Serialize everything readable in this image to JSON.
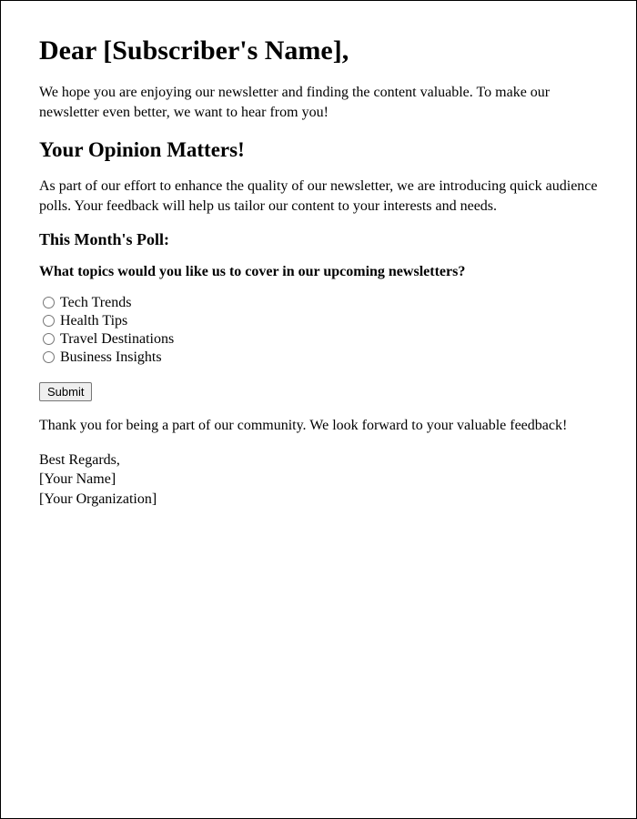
{
  "greeting": "Dear [Subscriber's Name],",
  "intro": "We hope you are enjoying our newsletter and finding the content valuable. To make our newsletter even better, we want to hear from you!",
  "section_heading": "Your Opinion Matters!",
  "section_body": "As part of our effort to enhance the quality of our newsletter, we are introducing quick audience polls. Your feedback will help us tailor our content to your interests and needs.",
  "poll_heading": "This Month's Poll:",
  "poll_question": "What topics would you like us to cover in our upcoming newsletters?",
  "options": {
    "0": "Tech Trends",
    "1": "Health Tips",
    "2": "Travel Destinations",
    "3": "Business Insights"
  },
  "submit_label": "Submit",
  "thanks": "Thank you for being a part of our community. We look forward to your valuable feedback!",
  "signoff": {
    "line1": "Best Regards,",
    "line2": "[Your Name]",
    "line3": "[Your Organization]"
  }
}
